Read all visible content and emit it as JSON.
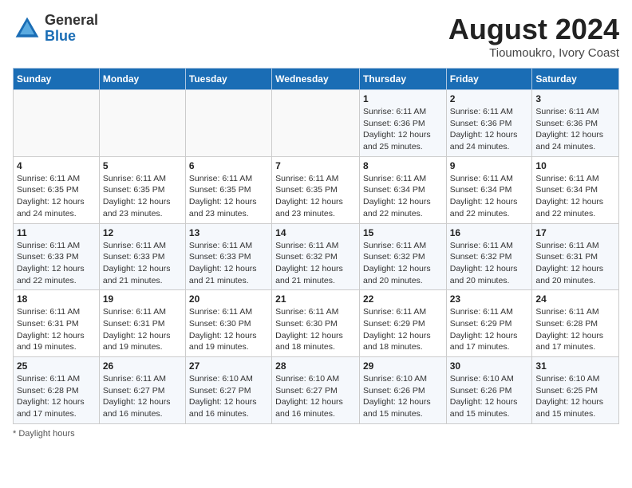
{
  "header": {
    "logo_general": "General",
    "logo_blue": "Blue",
    "month_year": "August 2024",
    "location": "Tioumoukro, Ivory Coast"
  },
  "footer": {
    "note": "Daylight hours"
  },
  "days_of_week": [
    "Sunday",
    "Monday",
    "Tuesday",
    "Wednesday",
    "Thursday",
    "Friday",
    "Saturday"
  ],
  "weeks": [
    [
      {
        "day": "",
        "info": ""
      },
      {
        "day": "",
        "info": ""
      },
      {
        "day": "",
        "info": ""
      },
      {
        "day": "",
        "info": ""
      },
      {
        "day": "1",
        "info": "Sunrise: 6:11 AM\nSunset: 6:36 PM\nDaylight: 12 hours\nand 25 minutes."
      },
      {
        "day": "2",
        "info": "Sunrise: 6:11 AM\nSunset: 6:36 PM\nDaylight: 12 hours\nand 24 minutes."
      },
      {
        "day": "3",
        "info": "Sunrise: 6:11 AM\nSunset: 6:36 PM\nDaylight: 12 hours\nand 24 minutes."
      }
    ],
    [
      {
        "day": "4",
        "info": "Sunrise: 6:11 AM\nSunset: 6:35 PM\nDaylight: 12 hours\nand 24 minutes."
      },
      {
        "day": "5",
        "info": "Sunrise: 6:11 AM\nSunset: 6:35 PM\nDaylight: 12 hours\nand 23 minutes."
      },
      {
        "day": "6",
        "info": "Sunrise: 6:11 AM\nSunset: 6:35 PM\nDaylight: 12 hours\nand 23 minutes."
      },
      {
        "day": "7",
        "info": "Sunrise: 6:11 AM\nSunset: 6:35 PM\nDaylight: 12 hours\nand 23 minutes."
      },
      {
        "day": "8",
        "info": "Sunrise: 6:11 AM\nSunset: 6:34 PM\nDaylight: 12 hours\nand 22 minutes."
      },
      {
        "day": "9",
        "info": "Sunrise: 6:11 AM\nSunset: 6:34 PM\nDaylight: 12 hours\nand 22 minutes."
      },
      {
        "day": "10",
        "info": "Sunrise: 6:11 AM\nSunset: 6:34 PM\nDaylight: 12 hours\nand 22 minutes."
      }
    ],
    [
      {
        "day": "11",
        "info": "Sunrise: 6:11 AM\nSunset: 6:33 PM\nDaylight: 12 hours\nand 22 minutes."
      },
      {
        "day": "12",
        "info": "Sunrise: 6:11 AM\nSunset: 6:33 PM\nDaylight: 12 hours\nand 21 minutes."
      },
      {
        "day": "13",
        "info": "Sunrise: 6:11 AM\nSunset: 6:33 PM\nDaylight: 12 hours\nand 21 minutes."
      },
      {
        "day": "14",
        "info": "Sunrise: 6:11 AM\nSunset: 6:32 PM\nDaylight: 12 hours\nand 21 minutes."
      },
      {
        "day": "15",
        "info": "Sunrise: 6:11 AM\nSunset: 6:32 PM\nDaylight: 12 hours\nand 20 minutes."
      },
      {
        "day": "16",
        "info": "Sunrise: 6:11 AM\nSunset: 6:32 PM\nDaylight: 12 hours\nand 20 minutes."
      },
      {
        "day": "17",
        "info": "Sunrise: 6:11 AM\nSunset: 6:31 PM\nDaylight: 12 hours\nand 20 minutes."
      }
    ],
    [
      {
        "day": "18",
        "info": "Sunrise: 6:11 AM\nSunset: 6:31 PM\nDaylight: 12 hours\nand 19 minutes."
      },
      {
        "day": "19",
        "info": "Sunrise: 6:11 AM\nSunset: 6:31 PM\nDaylight: 12 hours\nand 19 minutes."
      },
      {
        "day": "20",
        "info": "Sunrise: 6:11 AM\nSunset: 6:30 PM\nDaylight: 12 hours\nand 19 minutes."
      },
      {
        "day": "21",
        "info": "Sunrise: 6:11 AM\nSunset: 6:30 PM\nDaylight: 12 hours\nand 18 minutes."
      },
      {
        "day": "22",
        "info": "Sunrise: 6:11 AM\nSunset: 6:29 PM\nDaylight: 12 hours\nand 18 minutes."
      },
      {
        "day": "23",
        "info": "Sunrise: 6:11 AM\nSunset: 6:29 PM\nDaylight: 12 hours\nand 17 minutes."
      },
      {
        "day": "24",
        "info": "Sunrise: 6:11 AM\nSunset: 6:28 PM\nDaylight: 12 hours\nand 17 minutes."
      }
    ],
    [
      {
        "day": "25",
        "info": "Sunrise: 6:11 AM\nSunset: 6:28 PM\nDaylight: 12 hours\nand 17 minutes."
      },
      {
        "day": "26",
        "info": "Sunrise: 6:11 AM\nSunset: 6:27 PM\nDaylight: 12 hours\nand 16 minutes."
      },
      {
        "day": "27",
        "info": "Sunrise: 6:10 AM\nSunset: 6:27 PM\nDaylight: 12 hours\nand 16 minutes."
      },
      {
        "day": "28",
        "info": "Sunrise: 6:10 AM\nSunset: 6:27 PM\nDaylight: 12 hours\nand 16 minutes."
      },
      {
        "day": "29",
        "info": "Sunrise: 6:10 AM\nSunset: 6:26 PM\nDaylight: 12 hours\nand 15 minutes."
      },
      {
        "day": "30",
        "info": "Sunrise: 6:10 AM\nSunset: 6:26 PM\nDaylight: 12 hours\nand 15 minutes."
      },
      {
        "day": "31",
        "info": "Sunrise: 6:10 AM\nSunset: 6:25 PM\nDaylight: 12 hours\nand 15 minutes."
      }
    ]
  ]
}
